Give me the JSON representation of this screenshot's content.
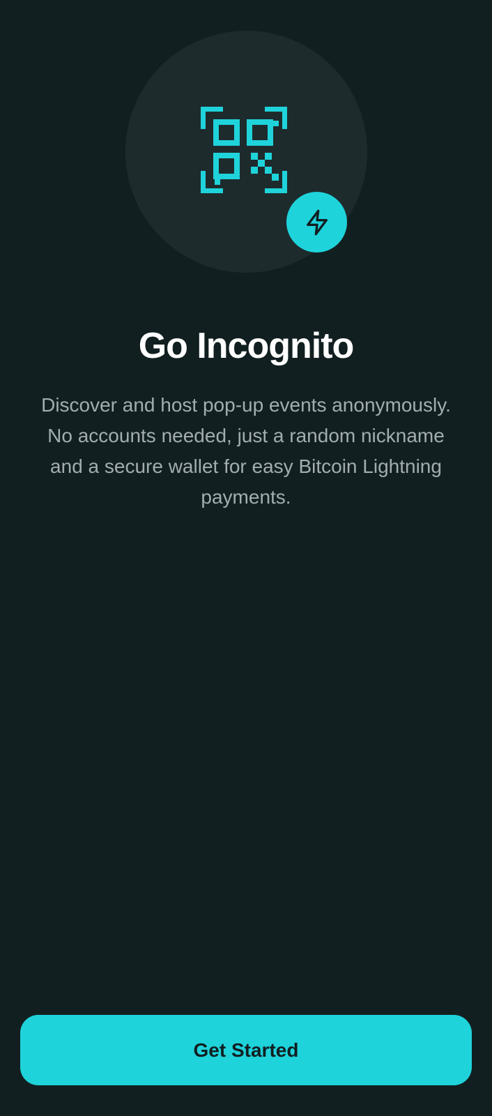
{
  "onboarding": {
    "title": "Go Incognito",
    "description": "Discover and host pop-up events anonymously. No accounts needed, just a random nickname and a secure wallet for easy Bitcoin Lightning payments.",
    "cta_label": "Get Started"
  },
  "icons": {
    "hero": "qr-code-icon",
    "badge": "lightning-bolt-icon"
  },
  "colors": {
    "background": "#121f20",
    "circle": "#1e2b2d",
    "accent": "#1fd3db",
    "title": "#ffffff",
    "description": "#a3adb0",
    "button_text": "#111f21"
  }
}
